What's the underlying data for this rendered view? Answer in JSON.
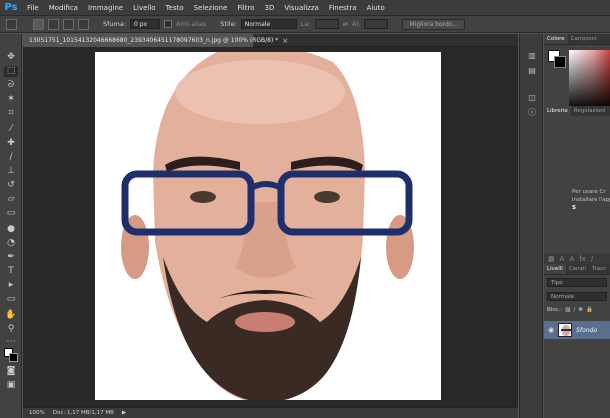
{
  "app": {
    "logo": "Ps"
  },
  "menu": [
    "File",
    "Modifica",
    "Immagine",
    "Livello",
    "Testo",
    "Selezione",
    "Filtro",
    "3D",
    "Visualizza",
    "Finestra",
    "Aiuto"
  ],
  "options": {
    "feather_label": "Sfuma:",
    "feather_value": "0 px",
    "antialias_label": "Anti-alias",
    "style_label": "Stile:",
    "style_value": "Normale",
    "width_label": "La:",
    "height_label": "Al:",
    "refine_button": "Migliora bordo..."
  },
  "document": {
    "tab_title": "13051751_10154132046668680_2393406451178097603_n.jpg @ 100% (RGB/8) *",
    "close_icon": "×"
  },
  "status": {
    "zoom": "100%",
    "doc_size": "Doc: 1,17 MB/1,17 MB"
  },
  "panels": {
    "color_tabs": [
      "Colore",
      "Campioni"
    ],
    "library_tabs": [
      "Librerie",
      "Regolazioni"
    ],
    "library_text_line1": "Per usare Cr",
    "library_text_line2": "installare l'app",
    "library_text_line3": "S",
    "layers_tabs": [
      "Livelli",
      "Canali",
      "Tracc"
    ],
    "filter_value": "Tipo",
    "blend_value": "Normale",
    "lock_label": "Bloc.:",
    "layer_name": "Sfondo"
  },
  "colors": {
    "foreground": "#ffffff",
    "background": "#000000",
    "accent": "#31a8ff"
  }
}
